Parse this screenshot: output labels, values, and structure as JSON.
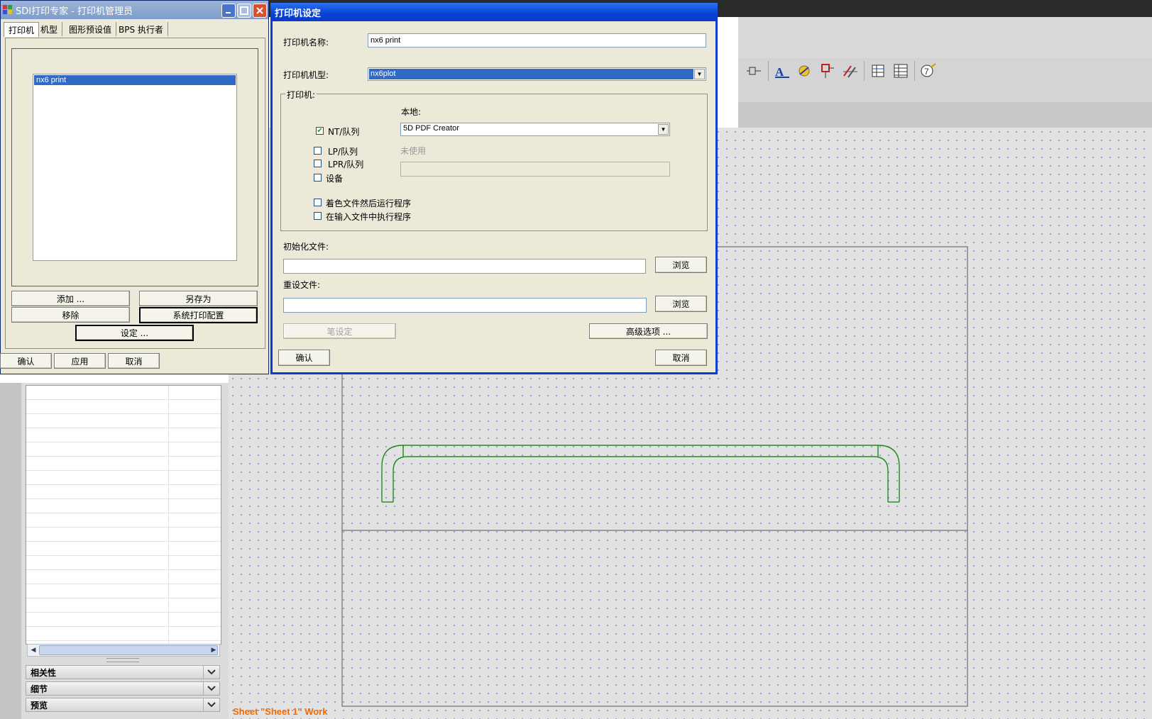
{
  "sheet_label": "Sheet \"Sheet 1\" Work",
  "nav_panel": {
    "sections": [
      {
        "label": "相关性"
      },
      {
        "label": "细节"
      },
      {
        "label": "预览"
      }
    ]
  },
  "manager_dialog": {
    "title": "SDI打印专家 - 打印机管理员",
    "tabs": [
      "打印机",
      "机型",
      "图形预设值",
      "BPS 执行者"
    ],
    "printers": [
      "nx6 print"
    ],
    "buttons": {
      "add": "添加 ...",
      "save_as": "另存为",
      "remove": "移除",
      "system_config": "系统打印配置",
      "setup": "设定 ...",
      "ok": "确认",
      "apply": "应用",
      "cancel": "取消"
    }
  },
  "setup_dialog": {
    "title": "打印机设定",
    "printer_name_label": "打印机名称:",
    "printer_name_value": "nx6 print",
    "printer_model_label": "打印机机型:",
    "printer_model_value": "nx6plot",
    "printer_group_label": "打印机:",
    "local_label": "本地:",
    "local_printer_value": "5D PDF Creator",
    "unused_label": "未使用",
    "options": {
      "nt_queue": {
        "label": "NT/队列",
        "checked": true
      },
      "lp_queue": {
        "label": "LP/队列",
        "checked": false
      },
      "lpr_queue": {
        "label": "LPR/队列",
        "checked": false
      },
      "device": {
        "label": "设备",
        "checked": false
      },
      "run_after_color": {
        "label": "着色文件然后运行程序",
        "checked": false
      },
      "run_in_input": {
        "label": "在输入文件中执行程序",
        "checked": false
      }
    },
    "init_file_label": "初始化文件:",
    "reset_file_label": "重设文件:",
    "browse_label": "浏览",
    "pen_setup_label": "笔设定",
    "advanced_label": "高级选项 ...",
    "ok_label": "确认",
    "cancel_label": "取消"
  },
  "colors": {
    "title_blue": "#0842d6",
    "selection_blue": "#316ac5",
    "drawing_green": "#1e8a1e",
    "sheet_label_orange": "#f26a00"
  }
}
